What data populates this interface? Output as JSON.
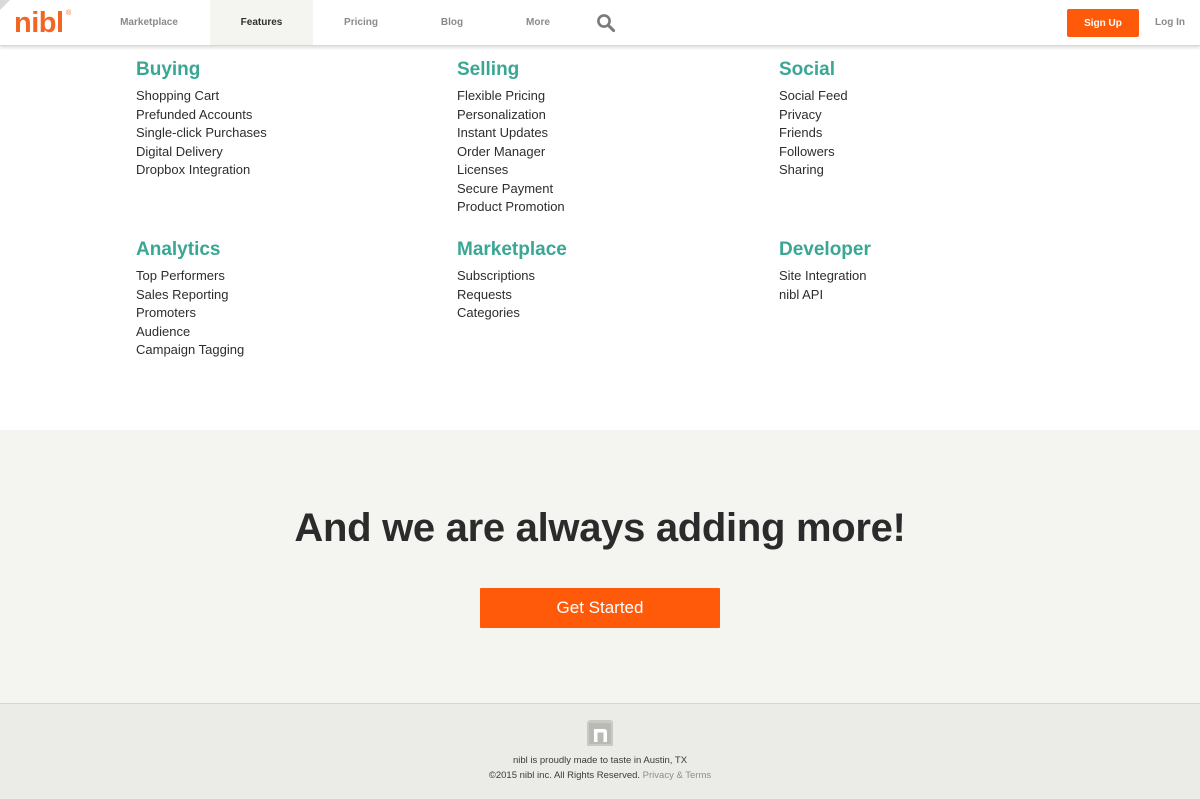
{
  "header": {
    "logo": "nibl",
    "logo_mark": "®",
    "nav": [
      {
        "label": "Marketplace",
        "active": false
      },
      {
        "label": "Features",
        "active": true
      },
      {
        "label": "Pricing",
        "active": false
      },
      {
        "label": "Blog",
        "active": false
      },
      {
        "label": "More",
        "active": false
      }
    ],
    "search_icon": "search-icon",
    "signup_label": "Sign Up",
    "login_label": "Log In"
  },
  "features": [
    {
      "title": "Buying",
      "items": [
        "Shopping Cart",
        "Prefunded Accounts",
        "Single-click Purchases",
        "Digital Delivery",
        "Dropbox Integration"
      ]
    },
    {
      "title": "Selling",
      "items": [
        "Flexible Pricing",
        "Personalization",
        "Instant Updates",
        "Order Manager",
        "Licenses",
        "Secure Payment",
        "Product Promotion"
      ]
    },
    {
      "title": "Social",
      "items": [
        "Social Feed",
        "Privacy",
        "Friends",
        "Followers",
        "Sharing"
      ]
    },
    {
      "title": "Analytics",
      "items": [
        "Top Performers",
        "Sales Reporting",
        "Promoters",
        "Audience",
        "Campaign Tagging"
      ]
    },
    {
      "title": "Marketplace",
      "items": [
        "Subscriptions",
        "Requests",
        "Categories"
      ]
    },
    {
      "title": "Developer",
      "items": [
        "Site Integration",
        "nibl API"
      ]
    }
  ],
  "cta": {
    "heading": "And we are always adding more!",
    "button_label": "Get Started"
  },
  "footer": {
    "logo_icon": "nibl-n-icon",
    "line1": "nibl is proudly made to taste in Austin, TX",
    "copyright": "©2015 nibl inc. All Rights Reserved.",
    "privacy_terms": "Privacy & Terms"
  },
  "colors": {
    "brand_orange": "#ff5a0a",
    "feature_teal": "#3aa795",
    "band_bg": "#f4f4f1",
    "footer_bg": "#ebebe7"
  }
}
